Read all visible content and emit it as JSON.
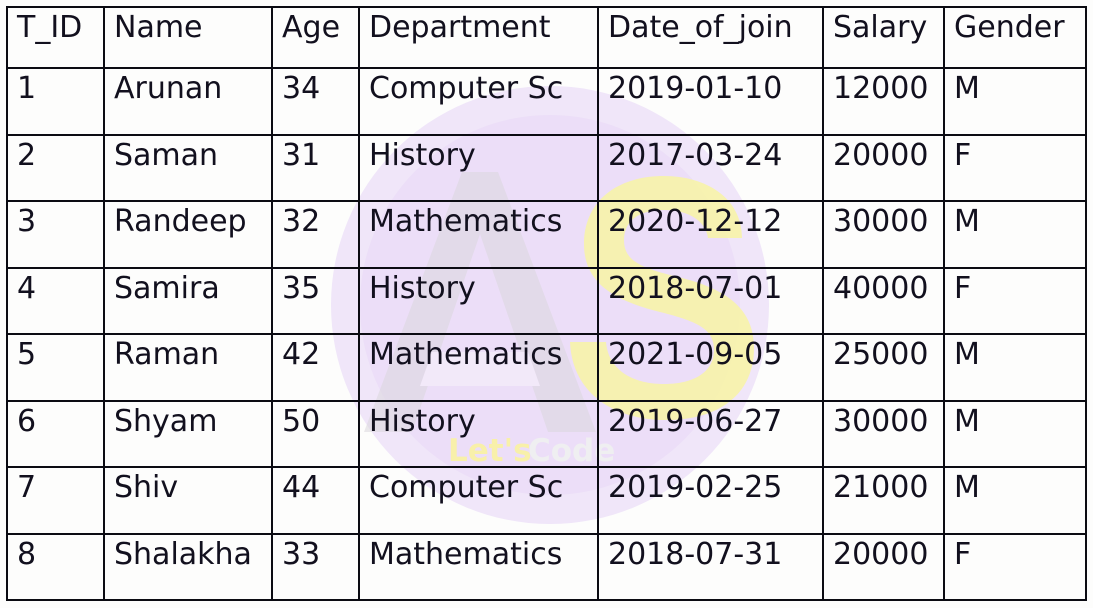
{
  "table": {
    "name": "teacher-table",
    "columns": [
      "T_ID",
      "Name",
      "Age",
      "Department",
      "Date_of_join",
      "Salary",
      "Gender"
    ],
    "rows": [
      {
        "t_id": "1",
        "name": "Arunan",
        "age": "34",
        "department": "Computer Sc",
        "date_of_join": "2019-01-10",
        "salary": "12000",
        "gender": "M"
      },
      {
        "t_id": "2",
        "name": "Saman",
        "age": "31",
        "department": "History",
        "date_of_join": "2017-03-24",
        "salary": "20000",
        "gender": "F"
      },
      {
        "t_id": "3",
        "name": "Randeep",
        "age": "32",
        "department": "Mathematics",
        "date_of_join": "2020-12-12",
        "salary": "30000",
        "gender": "M"
      },
      {
        "t_id": "4",
        "name": "Samira",
        "age": "35",
        "department": "History",
        "date_of_join": "2018-07-01",
        "salary": "40000",
        "gender": "F"
      },
      {
        "t_id": "5",
        "name": "Raman",
        "age": "42",
        "department": "Mathematics",
        "date_of_join": "2021-09-05",
        "salary": "25000",
        "gender": "M"
      },
      {
        "t_id": "6",
        "name": "Shyam",
        "age": "50",
        "department": "History",
        "date_of_join": "2019-06-27",
        "salary": "30000",
        "gender": "M"
      },
      {
        "t_id": "7",
        "name": "Shiv",
        "age": "44",
        "department": "Computer Sc",
        "date_of_join": "2019-02-25",
        "salary": "21000",
        "gender": "M"
      },
      {
        "t_id": "8",
        "name": "Shalakha",
        "age": "33",
        "department": "Mathematics",
        "date_of_join": "2018-07-31",
        "salary": "20000",
        "gender": "F"
      }
    ]
  },
  "watermark": {
    "letter_a": "A",
    "letter_s": "S",
    "tagline_yellow": "Let's",
    "tagline_grey": "Code",
    "circle_color": "#ece0f7",
    "letter_a_color": "#e6e2ea",
    "letter_s_color": "#f8f6b8",
    "tagline_yellow_color": "#f9f3b0",
    "tagline_grey_color": "#efeff0"
  },
  "colors": {
    "page_background": "#fdfdfc",
    "grid_line": "#0b0b12",
    "text": "#12101e"
  }
}
